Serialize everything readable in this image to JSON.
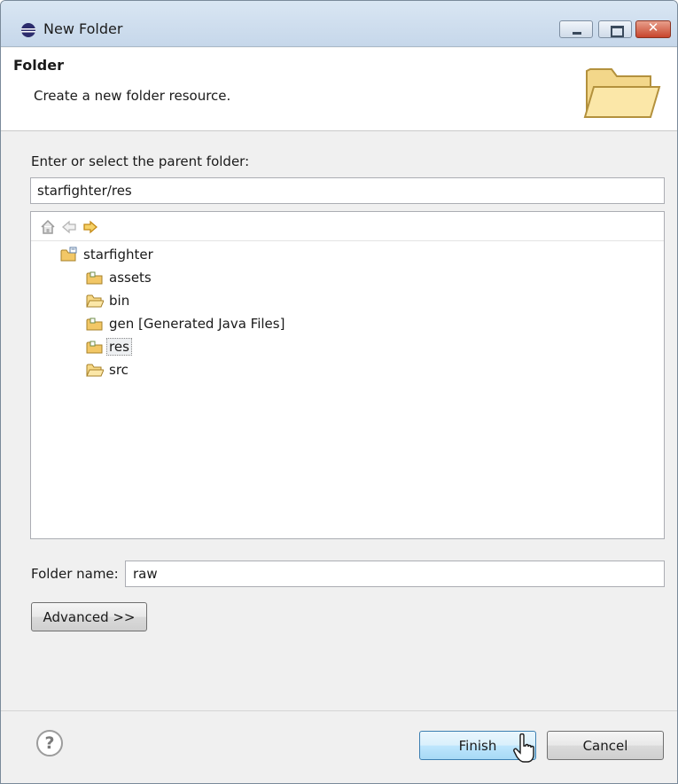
{
  "window": {
    "title": "New Folder"
  },
  "banner": {
    "title": "Folder",
    "description": "Create a new folder resource."
  },
  "parent": {
    "label": "Enter or select the parent folder:",
    "value": "starfighter/res"
  },
  "tree": {
    "toolbar_icons": [
      "home-icon",
      "back-arrow-icon",
      "forward-arrow-icon"
    ],
    "items": [
      {
        "label": "starfighter",
        "icon": "project-folder-icon",
        "level": 0,
        "selected": false
      },
      {
        "label": "assets",
        "icon": "source-folder-icon",
        "level": 1,
        "selected": false
      },
      {
        "label": "bin",
        "icon": "folder-icon",
        "level": 1,
        "selected": false
      },
      {
        "label": "gen [Generated Java Files]",
        "icon": "source-folder-icon",
        "level": 1,
        "selected": false
      },
      {
        "label": "res",
        "icon": "source-folder-icon",
        "level": 1,
        "selected": true
      },
      {
        "label": "src",
        "icon": "folder-icon",
        "level": 1,
        "selected": false
      }
    ]
  },
  "folder_name": {
    "label": "Folder name:",
    "value": "raw"
  },
  "buttons": {
    "advanced": "Advanced >>",
    "finish": "Finish",
    "cancel": "Cancel"
  },
  "footer": {
    "help_icon": "?"
  },
  "colors": {
    "folder": "#f2c766",
    "title_bar": "#c6d7ea",
    "close_button": "#c7452d",
    "finish_button": "#bee6fd"
  }
}
